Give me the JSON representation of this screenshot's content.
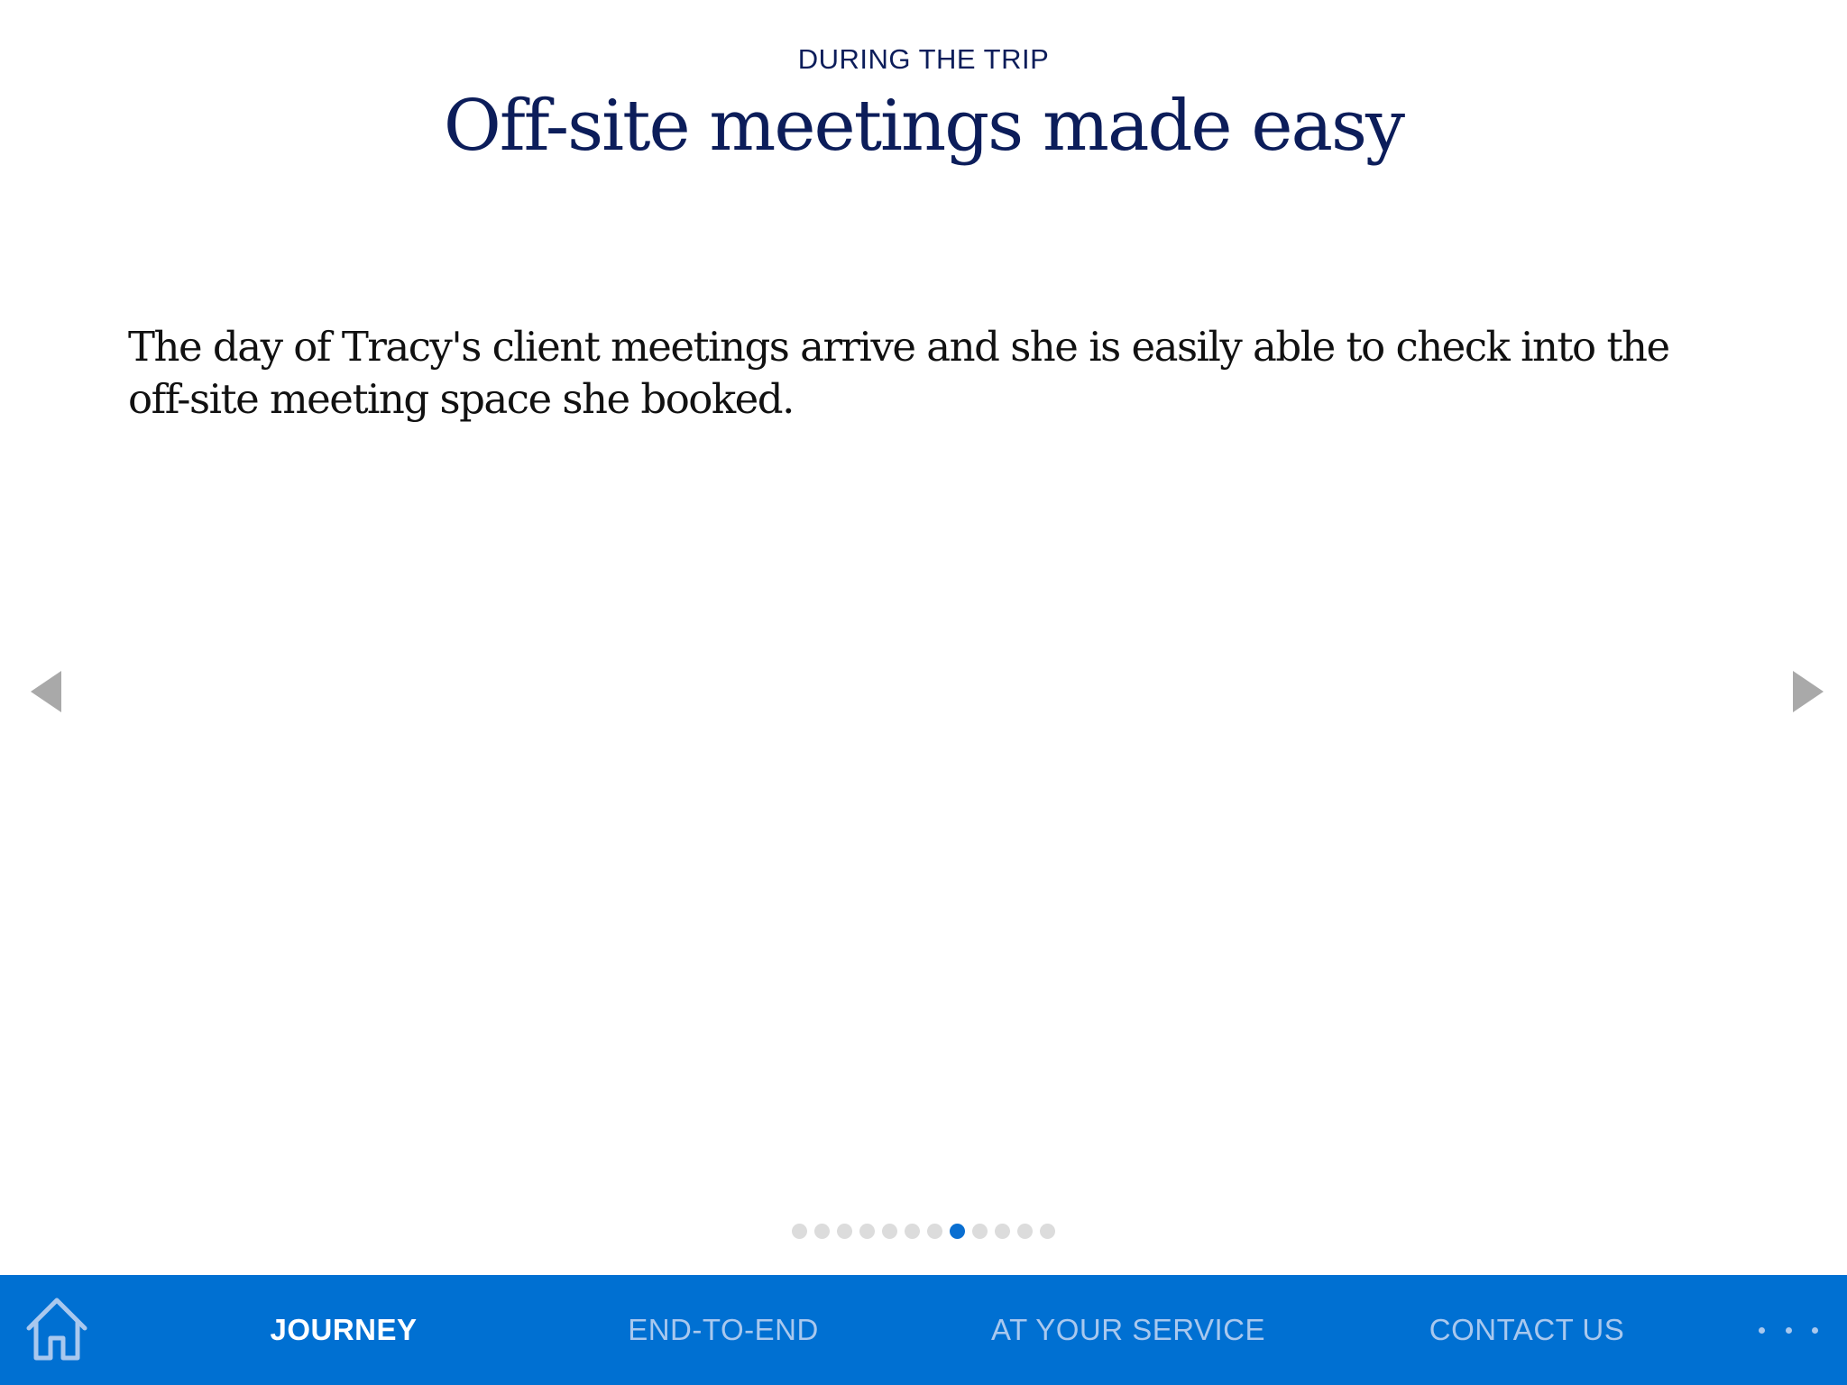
{
  "header": {
    "eyebrow": "DURING THE TRIP",
    "title": "Off-site meetings made easy"
  },
  "main": {
    "body": "The day of Tracy's client meetings arrive and she is easily able to check into the off-site meeting space she booked."
  },
  "carousel": {
    "total_pages": 12,
    "current_page": 8,
    "prev_icon": "triangle-left-icon",
    "next_icon": "triangle-right-icon"
  },
  "nav": {
    "home_icon": "home-icon",
    "items": [
      {
        "label": "JOURNEY",
        "active": true
      },
      {
        "label": "END-TO-END",
        "active": false
      },
      {
        "label": "AT YOUR SERVICE",
        "active": false
      },
      {
        "label": "CONTACT US",
        "active": false
      }
    ],
    "more_icon": "more-horizontal-icon"
  },
  "colors": {
    "navy": "#0c1d5a",
    "accent_blue": "#0070d2",
    "nav_inactive": "#a9c8ee",
    "arrow_gray": "#a9a9a9",
    "dot_inactive": "#dcdcdc"
  }
}
